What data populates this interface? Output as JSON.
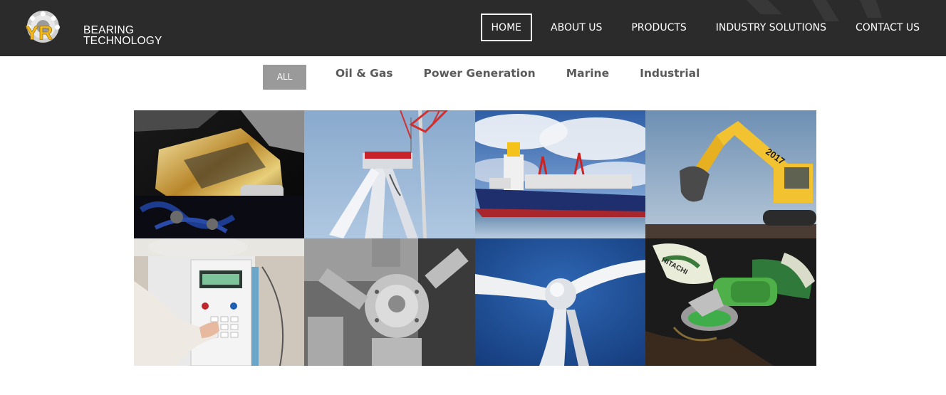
{
  "brand": {
    "logo_letters": "YR",
    "name_line1": "BEARING",
    "name_line2": "TECHNOLOGY",
    "accent": "#f5b915"
  },
  "nav": {
    "items": [
      {
        "label": "HOME",
        "active": true
      },
      {
        "label": "ABOUT US",
        "active": false
      },
      {
        "label": "PRODUCTS",
        "active": false
      },
      {
        "label": "INDUSTRY SOLUTIONS",
        "active": false
      },
      {
        "label": "CONTACT US",
        "active": false
      }
    ]
  },
  "filters": {
    "all_label": "ALL",
    "items": [
      "Oil & Gas",
      "Power Generation",
      "Marine",
      "Industrial"
    ]
  },
  "gallery": {
    "tiles": [
      {
        "subject": "engine-bay"
      },
      {
        "subject": "wind-turbine-crane"
      },
      {
        "subject": "cargo-ship"
      },
      {
        "subject": "excavator",
        "text": "2017"
      },
      {
        "subject": "lab-instrument"
      },
      {
        "subject": "vacuum-chamber"
      },
      {
        "subject": "wind-turbine-hub"
      },
      {
        "subject": "angle-grinder",
        "text": "HITACHI"
      }
    ]
  },
  "colors": {
    "header_bg": "#2b2b2b",
    "filter_active_bg": "#9a9a9a",
    "filter_text": "#5a5a5a"
  }
}
